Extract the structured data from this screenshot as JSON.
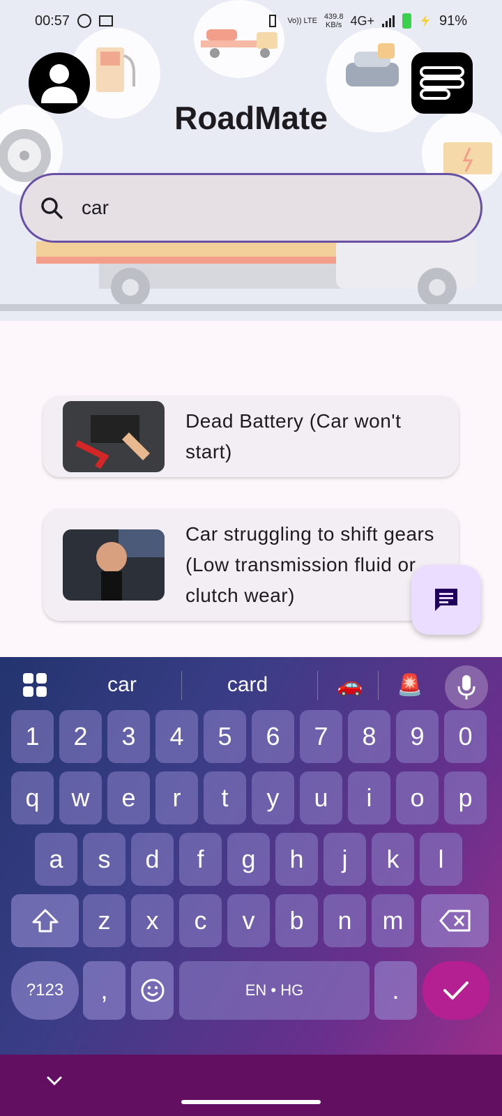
{
  "status": {
    "time": "00:57",
    "net_speed": "439.8",
    "net_unit": "KB/s",
    "network": "4G+",
    "volte": "Vo)) LTE",
    "battery": "91%"
  },
  "header": {
    "title": "RoadMate"
  },
  "search": {
    "value": "car"
  },
  "results": [
    {
      "label": "Dead Battery (Car won't start)"
    },
    {
      "label": "Car struggling to shift gears (Low transmission fluid or clutch wear)"
    }
  ],
  "keyboard": {
    "suggestions": [
      "car",
      "card"
    ],
    "emoji": [
      "🚗",
      "🚨"
    ],
    "rows": [
      [
        "1",
        "2",
        "3",
        "4",
        "5",
        "6",
        "7",
        "8",
        "9",
        "0"
      ],
      [
        "q",
        "w",
        "e",
        "r",
        "t",
        "y",
        "u",
        "i",
        "o",
        "p"
      ],
      [
        "a",
        "s",
        "d",
        "f",
        "g",
        "h",
        "j",
        "k",
        "l"
      ],
      [
        "z",
        "x",
        "c",
        "v",
        "b",
        "n",
        "m"
      ]
    ],
    "symbols_label": "?123",
    "comma": ",",
    "space_label": "EN • HG",
    "period": "."
  },
  "colors": {
    "accent": "#6750a4",
    "fab_bg": "#eaddff",
    "enter_key": "#b41f92",
    "nav_bar": "#620f61"
  }
}
